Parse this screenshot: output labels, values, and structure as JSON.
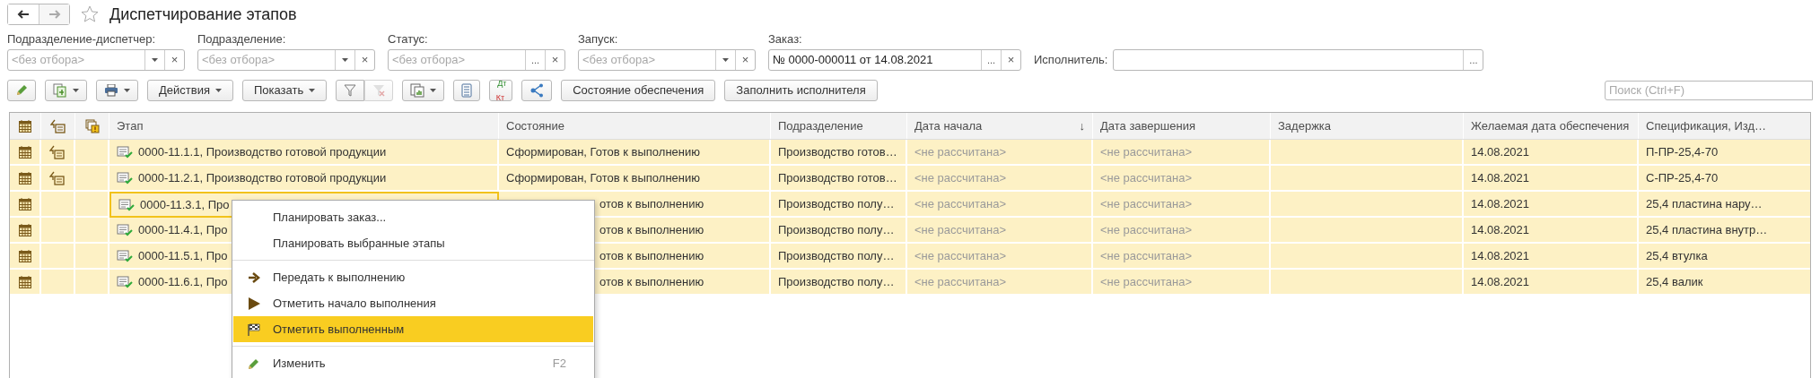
{
  "window": {
    "title": "Диспетчирование этапов",
    "favorite": false
  },
  "nav": [
    {
      "kind": "back",
      "disabled": false
    },
    {
      "kind": "forward",
      "disabled": true
    }
  ],
  "filters": [
    {
      "kind": "stacked",
      "label": "Подразделение-диспетчер:",
      "placeholder": "<без отбора>",
      "dropdown": true,
      "clear": "×"
    },
    {
      "kind": "stacked",
      "label": "Подразделение:",
      "placeholder": "<без отбора>",
      "dropdown": true,
      "clear": "×"
    },
    {
      "kind": "stacked",
      "label": "Статус:",
      "placeholder": "<без отбора>",
      "dropdown": false,
      "choose": "...",
      "clear": "×"
    },
    {
      "kind": "stacked",
      "label": "Запуск:",
      "placeholder": "<без отбора>",
      "dropdown": true,
      "clear": "×"
    },
    {
      "kind": "stacked",
      "label": "Заказ:",
      "value": "№ 0000-000011 от 14.08.2021",
      "dropdown": false,
      "choose": "...",
      "clear": "×"
    },
    {
      "kind": "inline",
      "label": "Исполнитель:",
      "dropdown": false,
      "choose": "..."
    }
  ],
  "toolbar": [
    {
      "kind": "edit",
      "dropdown": false
    },
    {
      "kind": "create",
      "dropdown": true
    },
    {
      "kind": "print",
      "dropdown": true
    },
    {
      "kind": "menu",
      "label": "Действия",
      "dropdown": true
    },
    {
      "kind": "menu",
      "label": "Показать",
      "dropdown": true
    },
    {
      "kind": "filter",
      "dropdown": false,
      "disabled": false
    },
    {
      "kind": "filter-clear",
      "dropdown": false,
      "disabled": true
    },
    {
      "kind": "report",
      "dropdown": true
    },
    {
      "kind": "list",
      "dropdown": false
    },
    {
      "kind": "dtkt",
      "top": "Дт",
      "bottom": "Кт",
      "dropdown": false
    },
    {
      "kind": "structure",
      "dropdown": false
    },
    {
      "kind": "button",
      "label": "Состояние обеспечения",
      "dropdown": false
    },
    {
      "kind": "button",
      "label": "Заполнить исполнителя",
      "dropdown": false
    }
  ],
  "search": {
    "placeholder": "Поиск (Ctrl+F)"
  },
  "table": {
    "icon_columns": [
      {
        "kind": "calendar"
      },
      {
        "kind": "shapes"
      },
      {
        "kind": "copies"
      }
    ],
    "columns": [
      {
        "label": "Этап"
      },
      {
        "label": "Состояние"
      },
      {
        "label": "Подразделение"
      },
      {
        "label": "Дата начала",
        "sort_mark": "↓",
        "dimmed": true
      },
      {
        "label": "Дата завершения",
        "dimmed": true
      },
      {
        "label": "Задержка"
      },
      {
        "label": "Желаемая дата обеспечения"
      },
      {
        "label": "Спецификация, Изд…"
      }
    ],
    "rows": [
      {
        "selected": false,
        "linked": true,
        "covered": false,
        "cells": [
          "0000-11.1.1, Производство готовой продукции",
          "Сформирован, Готов к выполнению",
          "Производство готов…",
          "<не рассчитана>",
          "<не рассчитана>",
          null,
          "14.08.2021",
          "П-ПР-25,4-70"
        ]
      },
      {
        "selected": false,
        "linked": true,
        "covered": false,
        "cells": [
          "0000-11.2.1, Производство готовой продукции",
          "Сформирован, Готов к выполнению",
          "Производство готов…",
          "<не рассчитана>",
          "<не рассчитана>",
          null,
          "14.08.2021",
          "С-ПР-25,4-70"
        ]
      },
      {
        "selected": true,
        "linked": false,
        "covered": true,
        "cells": [
          "0000-11.3.1, Про",
          "отов к выполнению",
          "Производство полу…",
          "<не рассчитана>",
          "<не рассчитана>",
          null,
          "14.08.2021",
          "25,4 пластина нару…"
        ]
      },
      {
        "selected": false,
        "linked": false,
        "covered": true,
        "cells": [
          "0000-11.4.1, Про",
          "отов к выполнению",
          "Производство полу…",
          "<не рассчитана>",
          "<не рассчитана>",
          null,
          "14.08.2021",
          "25,4 пластина внутр…"
        ]
      },
      {
        "selected": false,
        "linked": false,
        "covered": true,
        "cells": [
          "0000-11.5.1, Про",
          "отов к выполнению",
          "Производство полу…",
          "<не рассчитана>",
          "<не рассчитана>",
          null,
          "14.08.2021",
          "25,4 втулка"
        ]
      },
      {
        "selected": false,
        "linked": false,
        "covered": true,
        "cells": [
          "0000-11.6.1, Про",
          "отов к выполнению",
          "Производство полу…",
          "<не рассчитана>",
          "<не рассчитана>",
          null,
          "14.08.2021",
          "25,4 валик"
        ]
      }
    ]
  },
  "context_menu": [
    {
      "kind": "plain",
      "label": "Планировать заказ...",
      "selected": false
    },
    {
      "kind": "plain",
      "label": "Планировать выбранные этапы",
      "selected": false
    },
    {
      "kind": "separator"
    },
    {
      "kind": "arrow",
      "label": "Передать к выполнению",
      "selected": false
    },
    {
      "kind": "play",
      "label": "Отметить начало выполнения",
      "selected": false
    },
    {
      "kind": "flag",
      "label": "Отметить выполненным",
      "selected": true
    },
    {
      "kind": "separator"
    },
    {
      "kind": "pencil",
      "label": "Изменить",
      "shortcut": "F2",
      "selected": false
    }
  ]
}
